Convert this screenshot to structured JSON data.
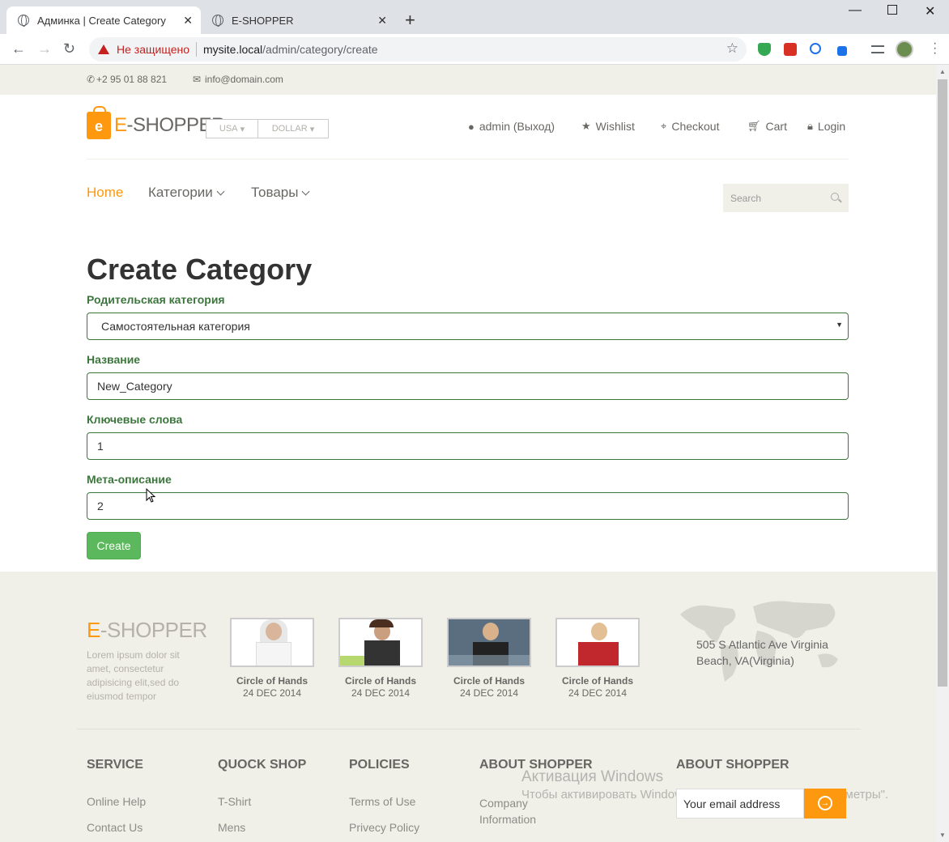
{
  "browser": {
    "tabs": [
      {
        "title": "Админка | Create Category",
        "active": true
      },
      {
        "title": "E-SHOPPER",
        "active": false
      }
    ],
    "security_label": "Не защищено",
    "url_host": "mysite.local",
    "url_path": "/admin/category/create"
  },
  "topbar": {
    "phone": "+2 95 01 88 821",
    "email": "info@domain.com"
  },
  "header": {
    "logo_letter": "e",
    "logo_text_accent": "E",
    "logo_text_rest": "-SHOPPER",
    "country_dropdown": "USA",
    "currency_dropdown": "DOLLAR",
    "user_menu": [
      {
        "label": "admin (Выход)",
        "icon": "user-icon"
      },
      {
        "label": "Wishlist",
        "icon": "star-icon"
      },
      {
        "label": "Checkout",
        "icon": "crosshairs-icon"
      },
      {
        "label": "Cart",
        "icon": "cart-icon"
      },
      {
        "label": "Login",
        "icon": "lock-icon"
      }
    ]
  },
  "nav": {
    "items": [
      {
        "label": "Home",
        "active": true
      },
      {
        "label": "Категории",
        "dropdown": true
      },
      {
        "label": "Товары",
        "dropdown": true
      }
    ],
    "search_placeholder": "Search"
  },
  "form": {
    "title": "Create Category",
    "fields": [
      {
        "label": "Родительская категория",
        "value": "Самостоятельная категория",
        "type": "select"
      },
      {
        "label": "Название",
        "value": "New_Category",
        "type": "text"
      },
      {
        "label": "Ключевые слова",
        "value": "1",
        "type": "text"
      },
      {
        "label": "Мета-описание",
        "value": "2",
        "type": "text"
      }
    ],
    "submit_label": "Create"
  },
  "footer": {
    "logo_accent": "E",
    "logo_rest": "-SHOPPER",
    "lorem": "Lorem ipsum dolor sit amet, consectetur adipisicing elit,sed do eiusmod tempor",
    "videos": [
      {
        "caption": "Circle of Hands",
        "date": "24 DEC 2014"
      },
      {
        "caption": "Circle of Hands",
        "date": "24 DEC 2014"
      },
      {
        "caption": "Circle of Hands",
        "date": "24 DEC 2014"
      },
      {
        "caption": "Circle of Hands",
        "date": "24 DEC 2014"
      }
    ],
    "address": "505 S Atlantic Ave Virginia Beach, VA(Virginia)",
    "columns": [
      {
        "heading": "SERVICE",
        "links": [
          "Online Help",
          "Contact Us"
        ]
      },
      {
        "heading": "QUOCK SHOP",
        "links": [
          "T-Shirt",
          "Mens"
        ]
      },
      {
        "heading": "POLICIES",
        "links": [
          "Terms of Use",
          "Privecy Policy"
        ]
      },
      {
        "heading": "ABOUT SHOPPER",
        "links": [
          "Company Information"
        ]
      },
      {
        "heading": "ABOUT SHOPPER",
        "links": []
      }
    ],
    "email_placeholder": "Your email address"
  },
  "os_watermark": {
    "line1": "Активация Windows",
    "line2": "Чтобы активировать Windows, перейдите в раздел \"Параметры\"."
  },
  "colors": {
    "accent": "#fe980f",
    "success": "#5cb85c",
    "form_label": "#3c763d",
    "footer_bg": "#f0f0e9"
  }
}
